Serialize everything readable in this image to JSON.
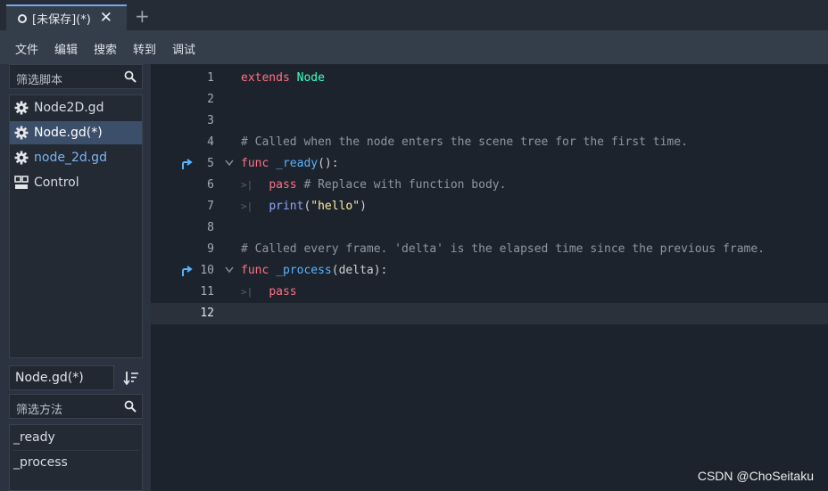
{
  "tab": {
    "title": "[未保存](*)",
    "close": "✕",
    "new_tab": "+"
  },
  "menu": [
    "文件",
    "编辑",
    "搜索",
    "转到",
    "调试"
  ],
  "scripts_filter": {
    "placeholder": "筛选脚本"
  },
  "scripts": [
    {
      "label": "Node2D.gd",
      "icon": "gear-icon",
      "color": "#d6dbe3",
      "selected": false
    },
    {
      "label": "Node.gd(*)",
      "icon": "gear-icon",
      "color": "#ffffff",
      "selected": true
    },
    {
      "label": "node_2d.gd",
      "icon": "gear-icon",
      "color": "#7cb3f0",
      "selected": false
    },
    {
      "label": "Control",
      "icon": "doc-icon",
      "color": "#d6dbe3",
      "selected": false
    }
  ],
  "current_script": "Node.gd(*)",
  "methods_filter": {
    "placeholder": "筛选方法"
  },
  "methods": [
    "_ready",
    "_process"
  ],
  "code_lines": [
    {
      "n": "1",
      "parts": [
        [
          "extends",
          "kw"
        ],
        [
          " ",
          ""
        ],
        [
          "Node",
          "ty"
        ]
      ]
    },
    {
      "n": "2",
      "parts": []
    },
    {
      "n": "3",
      "parts": []
    },
    {
      "n": "4",
      "parts": [
        [
          "# Called when the node enters the scene tree for the first time.",
          "cm"
        ]
      ]
    },
    {
      "n": "5",
      "parts": [
        [
          "func",
          "kw"
        ],
        [
          " ",
          ""
        ],
        [
          "_ready",
          "fn"
        ],
        [
          "():",
          "df"
        ]
      ],
      "override": true,
      "fold": true
    },
    {
      "n": "6",
      "parts": [
        [
          "    ",
          ""
        ],
        [
          "pass",
          "kw"
        ],
        [
          " ",
          ""
        ],
        [
          "# Replace with function body.",
          "cm"
        ]
      ],
      "tab": true
    },
    {
      "n": "7",
      "parts": [
        [
          "    ",
          ""
        ],
        [
          "print",
          "bi"
        ],
        [
          "(",
          "df"
        ],
        [
          "\"hello\"",
          "st"
        ],
        [
          ")",
          "df"
        ]
      ],
      "tab": true
    },
    {
      "n": "8",
      "parts": []
    },
    {
      "n": "9",
      "parts": [
        [
          "# Called every frame. 'delta' is the elapsed time since the previous frame.",
          "cm"
        ]
      ]
    },
    {
      "n": "10",
      "parts": [
        [
          "func",
          "kw"
        ],
        [
          " ",
          ""
        ],
        [
          "_process",
          "fn"
        ],
        [
          "(delta):",
          "df"
        ]
      ],
      "override": true,
      "fold": true
    },
    {
      "n": "11",
      "parts": [
        [
          "    ",
          ""
        ],
        [
          "pass",
          "kw"
        ]
      ],
      "tab": true
    },
    {
      "n": "12",
      "parts": [],
      "current": true
    }
  ],
  "watermark": "CSDN @ChoSeitaku",
  "colors": {
    "accent": "#6fa9e8",
    "keyword": "#ff7085",
    "type": "#42ffc2",
    "comment": "#8e96a0",
    "function": "#57b3ff",
    "string": "#ffeda1",
    "builtin": "#8fa3ff"
  }
}
